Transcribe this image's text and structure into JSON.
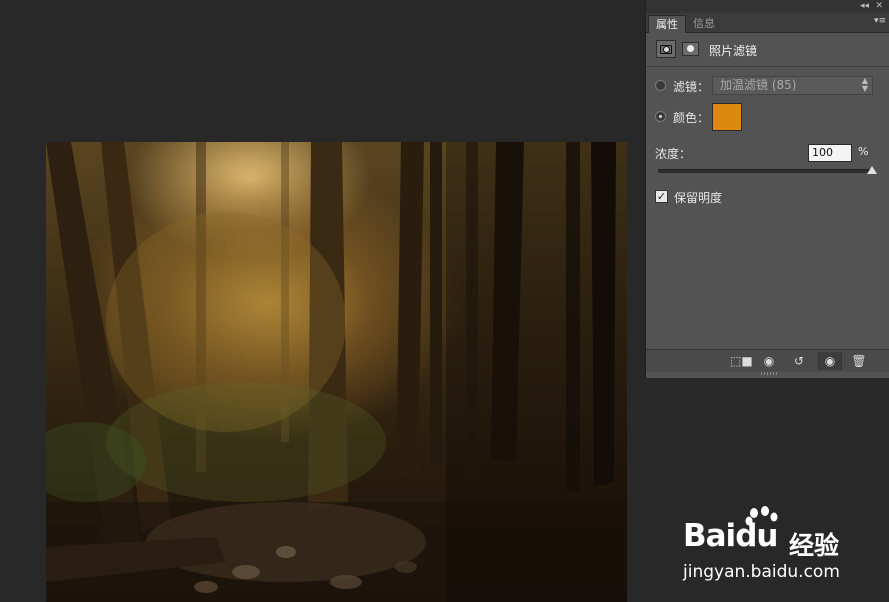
{
  "panel": {
    "tabs": [
      {
        "label": "属性"
      },
      {
        "label": "信息"
      }
    ],
    "title": "照片滤镜",
    "filter": {
      "label": "滤镜：",
      "value": "加温滤镜 (85)"
    },
    "color": {
      "label": "颜色：",
      "swatch": "#dc8a0f"
    },
    "density": {
      "label": "浓度：",
      "value": "100",
      "unit": "%",
      "level": 1.0
    },
    "preserve_luminosity": {
      "label": "保留明度",
      "checked": true
    },
    "icons": {
      "collapse": "collapse-icon",
      "close": "close-icon",
      "menu": "panel-menu-icon",
      "adjustment": "photo-filter-icon",
      "mask": "mask-icon",
      "clip": "clip-to-layer-icon",
      "view_previous": "view-previous-icon",
      "reset": "reset-icon",
      "visibility": "eye-icon",
      "delete": "trash-icon"
    }
  },
  "watermark": {
    "brand": "Bai",
    "brand_du": "du",
    "brand_cn": "经验",
    "url": "jingyan.baidu.com"
  }
}
